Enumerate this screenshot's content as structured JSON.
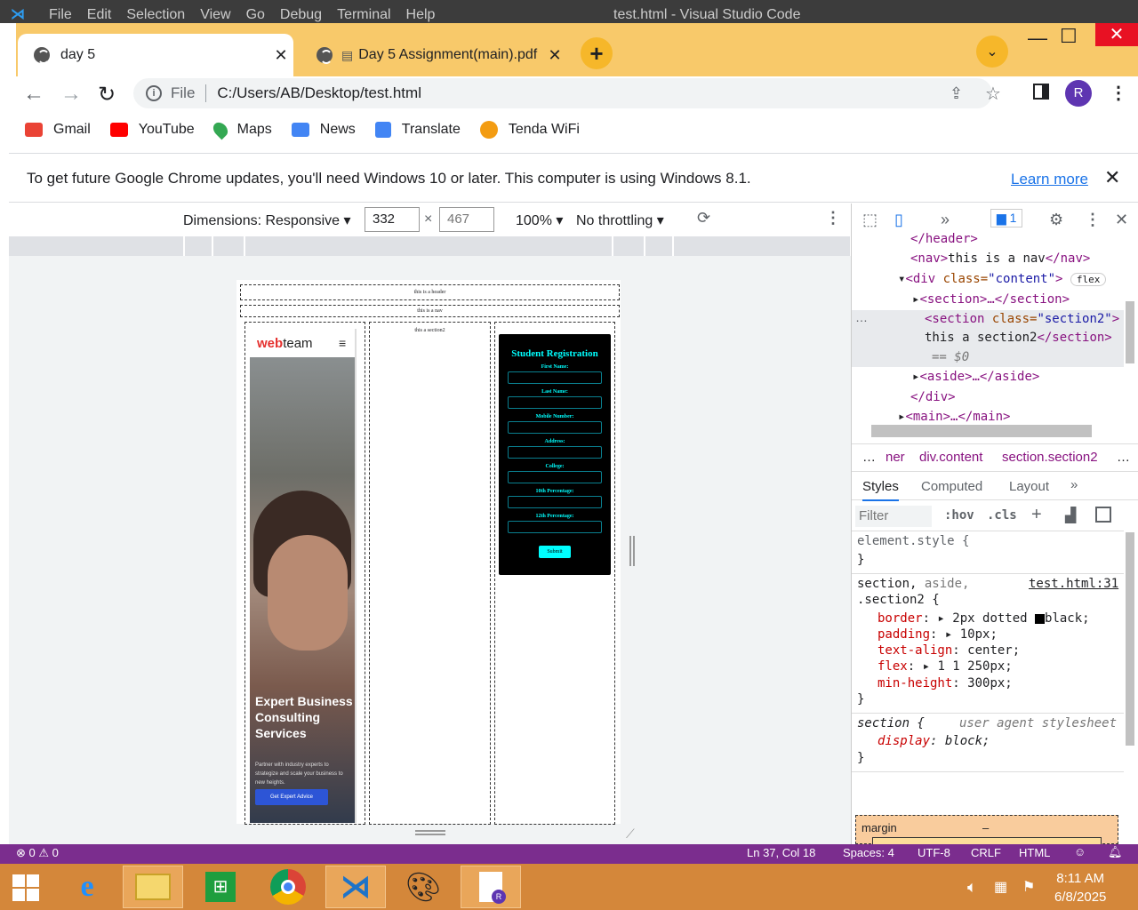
{
  "vscode": {
    "menu": [
      "File",
      "Edit",
      "Selection",
      "View",
      "Go",
      "Debug",
      "Terminal",
      "Help"
    ],
    "title": "test.html - Visual Studio Code",
    "status_left": "⊗ 0 ⚠ 0",
    "status_right": [
      "Ln 37, Col 18",
      "Spaces: 4",
      "UTF-8",
      "CRLF",
      "HTML"
    ]
  },
  "tabs": [
    {
      "label": "day 5",
      "active": true
    },
    {
      "label": "Day 5 Assignment(main).pdf",
      "active": false
    }
  ],
  "address": {
    "scheme_label": "File",
    "url": "C:/Users/AB/Desktop/test.html",
    "profile_initial": "R"
  },
  "bookmarks": [
    {
      "label": "Gmail",
      "icon": "gmail-icon",
      "color": "#ea4335"
    },
    {
      "label": "YouTube",
      "icon": "youtube-icon",
      "color": "#ff0000"
    },
    {
      "label": "Maps",
      "icon": "maps-icon",
      "color": "#34a853"
    },
    {
      "label": "News",
      "icon": "news-icon",
      "color": "#4285f4"
    },
    {
      "label": "Translate",
      "icon": "translate-icon",
      "color": "#4285f4"
    },
    {
      "label": "Tenda WiFi",
      "icon": "tenda-icon",
      "color": "#f39c12"
    }
  ],
  "infobar": {
    "message": "To get future Google Chrome updates, you'll need Windows 10 or later. This computer is using Windows 8.1.",
    "link": "Learn more"
  },
  "device_toolbar": {
    "dimensions": "Dimensions: Responsive",
    "width": "332",
    "height": "467",
    "zoom": "100%",
    "throttling": "No throttling"
  },
  "page": {
    "header": "this is a header",
    "nav": "this is a nav",
    "section2": "this a section2",
    "phone": {
      "logo_red": "web",
      "logo_dark": "team",
      "headline": "Expert Business Consulting Services",
      "subtext": "Partner with industry experts to strategize and scale your business to new heights.",
      "button": "Get Expert Advice"
    },
    "form": {
      "title": "Student Registration",
      "fields": [
        "First Name:",
        "Last Name:",
        "Mobile Number:",
        "Address:",
        "College:",
        "10th Percentage:",
        "12th Percentage:"
      ],
      "submit": "Submit"
    }
  },
  "devtools": {
    "issues_count": "1",
    "dom": {
      "line1": "</header>",
      "line2_a": "<nav>",
      "line2_b": "this is a nav",
      "line2_c": "</nav>",
      "line3_tag": "<div ",
      "line3_attr": "class=",
      "line3_val": "\"content\"",
      "line3_end": ">",
      "flex_badge": "flex",
      "line4": "<section>…</section>",
      "line5_tag": "<section ",
      "line5_attr": "class=",
      "line5_val": "\"section2\"",
      "line5_end": ">",
      "line6_text": "this a section2",
      "line6_end": "</section>",
      "line7": "== $0",
      "line8": "<aside>…</aside>",
      "line9": "</div>",
      "line10": "<main>…</main>"
    },
    "breadcrumb": [
      "…",
      "ner",
      "div.content",
      "section.section2",
      "…"
    ],
    "tabs": [
      "Styles",
      "Computed",
      "Layout"
    ],
    "filter_placeholder": "Filter",
    "hov": ":hov",
    "cls": ".cls",
    "rule1_selector": "element.style {",
    "rule1_close": "}",
    "rule2_selector_a": "section, ",
    "rule2_selector_b": "aside,",
    "rule2_selector_c": ".section2 {",
    "rule2_source": "test.html:31",
    "decls": [
      {
        "prop": "border",
        "value": "2px dotted ",
        "extra": "black;"
      },
      {
        "prop": "padding",
        "value": "10px;"
      },
      {
        "prop": "text-align",
        "value": "center;"
      },
      {
        "prop": "flex",
        "value": "1 1 250px;"
      },
      {
        "prop": "min-height",
        "value": "300px;"
      }
    ],
    "rule2_close": "}",
    "rule3_selector": "section {",
    "rule3_source": "user agent stylesheet",
    "rule3_prop": "display",
    "rule3_value": "block;",
    "rule3_close": "}",
    "box_model_label": "margin",
    "box_model_value": "–"
  },
  "taskbar": {
    "time": "8:11 AM",
    "date": "6/8/2025",
    "apps": [
      "ie-icon",
      "file-explorer-icon",
      "store-icon",
      "chrome-icon",
      "vscode-icon",
      "paint-icon",
      "document-icon"
    ]
  }
}
